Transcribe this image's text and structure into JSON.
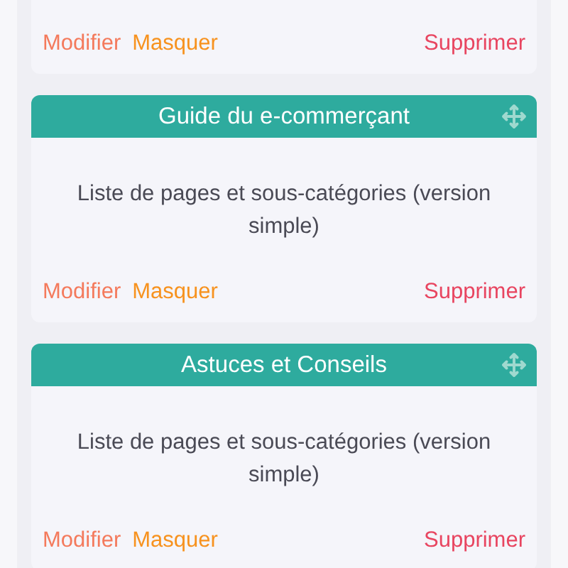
{
  "cards": [
    {
      "actions": {
        "edit": "Modifier",
        "hide": "Masquer",
        "delete": "Supprimer"
      }
    },
    {
      "title": "Guide du e-commerçant",
      "description": "Liste de pages et sous-catégories (version simple)",
      "actions": {
        "edit": "Modifier",
        "hide": "Masquer",
        "delete": "Supprimer"
      }
    },
    {
      "title": "Astuces et Conseils",
      "description": "Liste de pages et sous-catégories (version simple)",
      "actions": {
        "edit": "Modifier",
        "hide": "Masquer",
        "delete": "Supprimer"
      }
    }
  ]
}
